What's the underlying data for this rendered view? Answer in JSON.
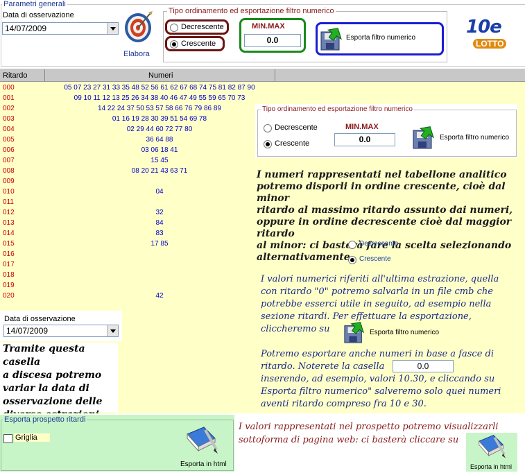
{
  "params": {
    "legend": "Parametri generali",
    "date_label": "Data di osservazione",
    "date_value": "14/07/2009",
    "elabora_label": "Elabora"
  },
  "sort_top": {
    "legend": "Tipo ordinamento ed esportazione filtro numerico",
    "decrescente": "Decrescente",
    "crescente": "Crescente",
    "minmax_label": "MIN.MAX",
    "minmax_value": "0.0",
    "export_label": "Esporta filtro numerico"
  },
  "logo": {
    "big": "10e",
    "small": "LOTTO"
  },
  "table": {
    "col_ritardo": "Ritardo",
    "col_numeri": "Numeri",
    "rows": [
      {
        "r": "000",
        "n": "05 07 23 27 31 33 35 48 52 56 61 62 67 68 74 75 81 82 87 90"
      },
      {
        "r": "001",
        "n": "09 10 11 12 13 25 26 34 38 40 46 47 49 55 59 65 70 73"
      },
      {
        "r": "002",
        "n": "14 22 24 37 50 53 57 58 66 76 79 86 89"
      },
      {
        "r": "003",
        "n": "01 16 19 28 30 39 51 54 69 78"
      },
      {
        "r": "004",
        "n": "02 29 44 60 72 77 80"
      },
      {
        "r": "005",
        "n": "36 64 88"
      },
      {
        "r": "006",
        "n": "03 06 18 41"
      },
      {
        "r": "007",
        "n": "15 45"
      },
      {
        "r": "008",
        "n": "08 20 21 43 63 71"
      },
      {
        "r": "009",
        "n": ""
      },
      {
        "r": "010",
        "n": "04"
      },
      {
        "r": "011",
        "n": ""
      },
      {
        "r": "012",
        "n": "32"
      },
      {
        "r": "013",
        "n": "84"
      },
      {
        "r": "014",
        "n": "83"
      },
      {
        "r": "015",
        "n": "17 85"
      },
      {
        "r": "016",
        "n": ""
      },
      {
        "r": "017",
        "n": ""
      },
      {
        "r": "018",
        "n": ""
      },
      {
        "r": "019",
        "n": ""
      },
      {
        "r": "020",
        "n": "42"
      }
    ]
  },
  "sort_inner": {
    "legend": "Tipo ordinamento ed esportazione filtro numerico",
    "decrescente": "Decrescente",
    "crescente": "Crescente",
    "minmax_label": "MIN.MAX",
    "minmax_value": "0.0",
    "export_label": "Esporta filtro numerico"
  },
  "note1": {
    "l1": "I numeri rappresentati nel tabellone analitico",
    "l2": "potremo disporli in ordine crescente, cioè dal minor",
    "l3": "ritardo al massimo ritardo assunto dai numeri,",
    "l4": "oppure in ordine decrescente cioè dal maggior ritardo",
    "l5": "al minor: ci basterà fare la scelta selezionando",
    "l6": "alternativamente",
    "decrescente": "Decrescente",
    "crescente": "Crescente"
  },
  "note2": {
    "l1": "I valori numerici riferiti all'ultima estrazione, quella",
    "l2": "con ritardo \"0\" potremo salvarla in un file cmb che",
    "l3": "potrebbe esserci utile in seguito, ad esempio nella",
    "l4": "sezione ritardi. Per effettuare la esportazione,",
    "l5": "cliccheremo su",
    "export_label": "Esporta filtro numerico",
    "p2l1": "Potremo esportare anche numeri in base a fasce di",
    "p2l2": "ritardo. Noterete la casella",
    "p2_box": "0.0",
    "p2l3": "inserendo, ad esempio, valori 10.30,  e cliccando su",
    "p2l4": "Esporta filtro numerico\" salveremo solo quei numeri",
    "p2l5": "aventi ritardo compreso fra 10 e 30."
  },
  "date_box": {
    "label": "Data di osservazione",
    "value": "14/07/2009"
  },
  "note3": {
    "l1": "Tramite questa casella",
    "l2": "a discesa potremo",
    "l3": "variar la data di",
    "l4": "osservazione delle",
    "l5": "diverse estrazioni"
  },
  "export_panel": {
    "legend": "Esporta prospetto ritardi",
    "griglia": "Griglia",
    "html_label": "Esporta in html"
  },
  "note4": {
    "l1": "I valori rappresentati nel prospetto potremo visualizzarli",
    "l2": "sottoforma di pagina web: ci basterà cliccare su",
    "html_label": "Esporta in html"
  },
  "colors": {
    "yellow": "#ffffc8",
    "green": "#c8f5c8",
    "maroon": "#6b1414",
    "green_box": "#1b8a1b",
    "blue_box": "#1b1bd6"
  }
}
